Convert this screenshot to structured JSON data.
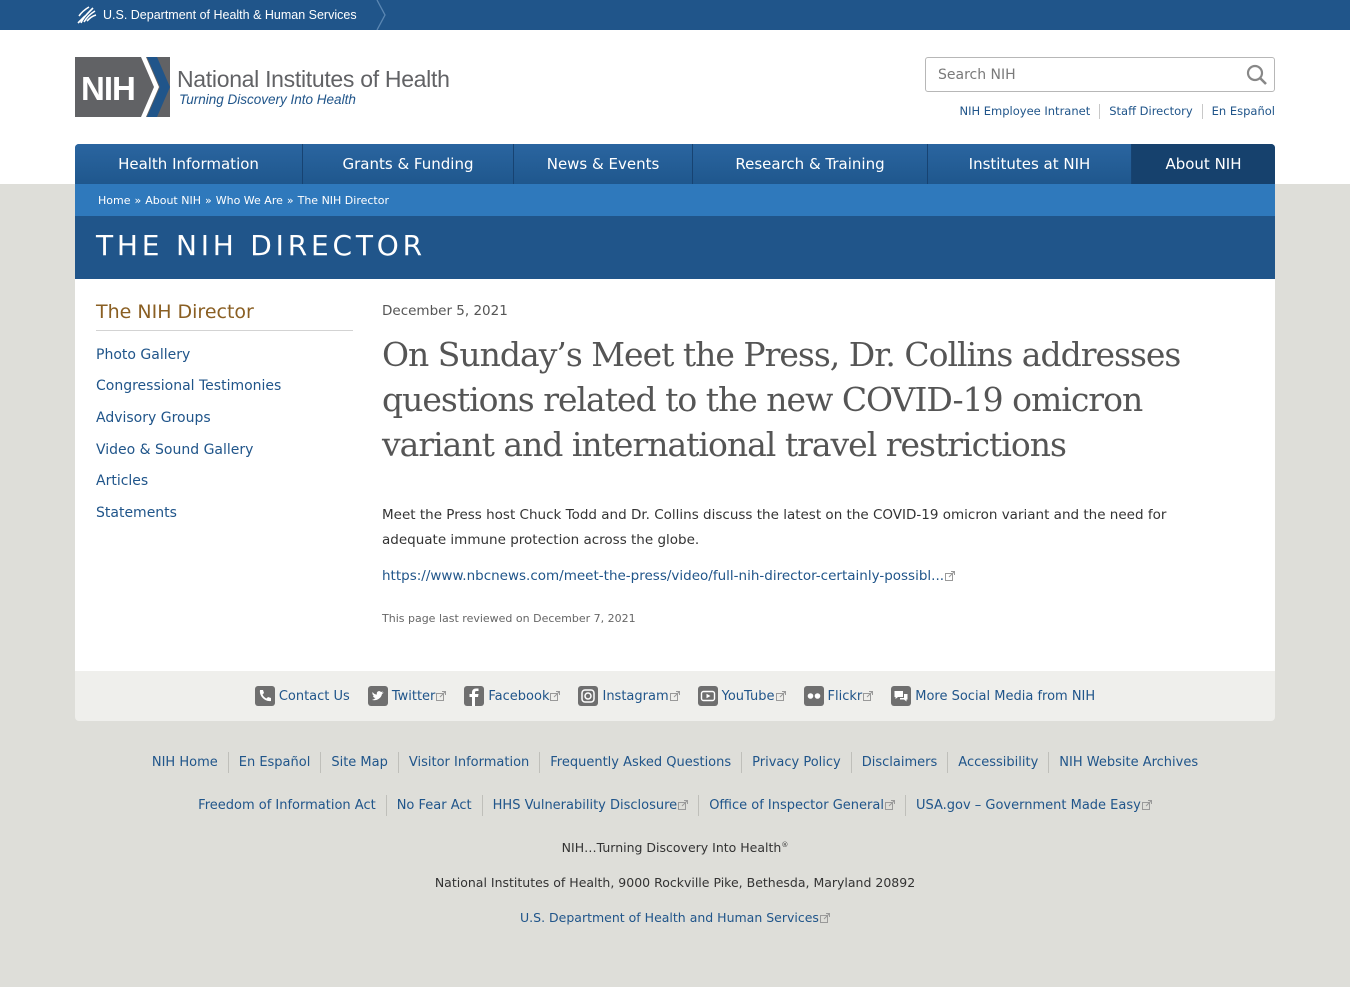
{
  "hhs_bar": {
    "label": "U.S. Department of Health & Human Services"
  },
  "logo": {
    "abbr": "NIH",
    "name": "National Institutes of Health",
    "tagline": "Turning Discovery Into Health"
  },
  "search": {
    "placeholder": "Search NIH"
  },
  "utility_links": [
    "NIH Employee Intranet",
    "Staff Directory",
    "En Español"
  ],
  "main_nav": [
    "Health Information",
    "Grants & Funding",
    "News & Events",
    "Research & Training",
    "Institutes at NIH",
    "About NIH"
  ],
  "breadcrumb": [
    "Home",
    "About NIH",
    "Who We Are",
    "The NIH Director"
  ],
  "banner": {
    "title": "THE NIH DIRECTOR"
  },
  "sidebar": {
    "title": "The NIH Director",
    "items": [
      "Photo Gallery",
      "Congressional Testimonies",
      "Advisory Groups",
      "Video & Sound Gallery",
      "Articles",
      "Statements"
    ]
  },
  "article": {
    "date": "December 5, 2021",
    "title": "On Sunday’s Meet the Press, Dr. Collins addresses questions related to the new COVID-19 omicron variant and international travel restrictions",
    "body": "Meet the Press host Chuck Todd and Dr. Collins discuss the latest on the COVID-19 omicron variant and the need for adequate immune protection across the globe.",
    "link": "https://www.nbcnews.com/meet-the-press/video/full-nih-director-certainly-possibl...",
    "reviewed": "This page last reviewed on December 7, 2021"
  },
  "social": [
    {
      "label": "Contact Us",
      "icon": "phone-icon"
    },
    {
      "label": "Twitter",
      "icon": "twitter-icon"
    },
    {
      "label": "Facebook",
      "icon": "facebook-icon"
    },
    {
      "label": "Instagram",
      "icon": "instagram-icon"
    },
    {
      "label": "YouTube",
      "icon": "youtube-icon"
    },
    {
      "label": "Flickr",
      "icon": "flickr-icon"
    },
    {
      "label": "More Social Media from NIH",
      "icon": "chat-icon"
    }
  ],
  "footer": {
    "row1": [
      "NIH Home",
      "En Español",
      "Site Map",
      "Visitor Information",
      "Frequently Asked Questions",
      "Privacy Policy",
      "Disclaimers",
      "Accessibility",
      "NIH Website Archives"
    ],
    "row2": [
      "Freedom of Information Act",
      "No Fear Act",
      "HHS Vulnerability Disclosure",
      "Office of Inspector General",
      "USA.gov – Government Made Easy"
    ],
    "tagline": "NIH…Turning Discovery Into Health",
    "tagline_mark": "®",
    "address": "National Institutes of Health, 9000 Rockville Pike, Bethesda, Maryland 20892",
    "hhs_link": "U.S. Department of Health and Human Services"
  },
  "colors": {
    "primary": "#20558a",
    "breadcrumb": "#2f79bc",
    "sidebar_title": "#8a5f23",
    "page_bg": "#deded9"
  }
}
